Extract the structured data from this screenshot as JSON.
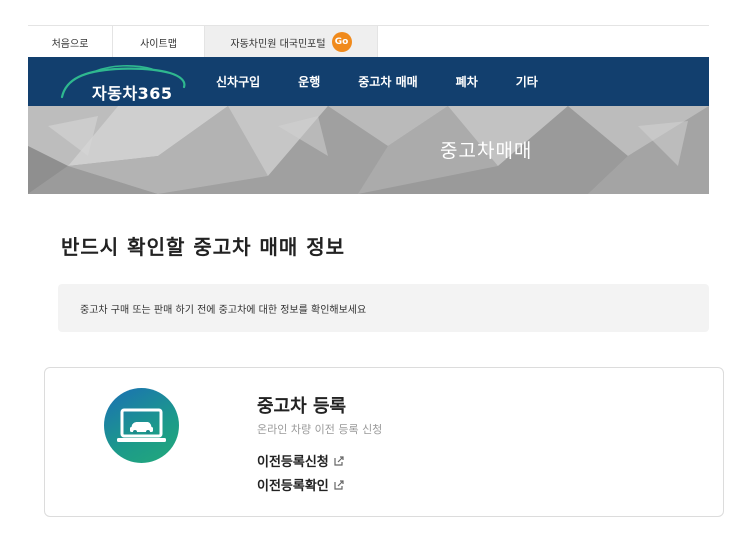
{
  "utility_bar": {
    "tabs": [
      "처음으로",
      "사이트맵",
      "자동차민원 대국민포털"
    ],
    "go_label": "Go"
  },
  "nav": {
    "logo_text": "자동차365",
    "menu": [
      "신차구입",
      "운행",
      "중고차 매매",
      "폐차",
      "기타"
    ]
  },
  "banner": {
    "title": "중고차매매"
  },
  "section": {
    "title": "반드시 확인할 중고차 매매 정보",
    "notice": "중고차 구매 또는 판매 하기 전에 중고차에 대한 정보를 확인해보세요"
  },
  "card": {
    "title": "중고차 등록",
    "subtitle": "온라인 차량 이전 등록 신청",
    "links": [
      "이전등록신청",
      "이전등록확인"
    ],
    "icon": "laptop-car-icon",
    "link_icon": "external-link-icon"
  },
  "colors": {
    "nav_bg": "#123f6e",
    "go_badge": "#f08a1c",
    "icon_gradient_start": "#1b6fb5",
    "icon_gradient_end": "#23a97a"
  }
}
